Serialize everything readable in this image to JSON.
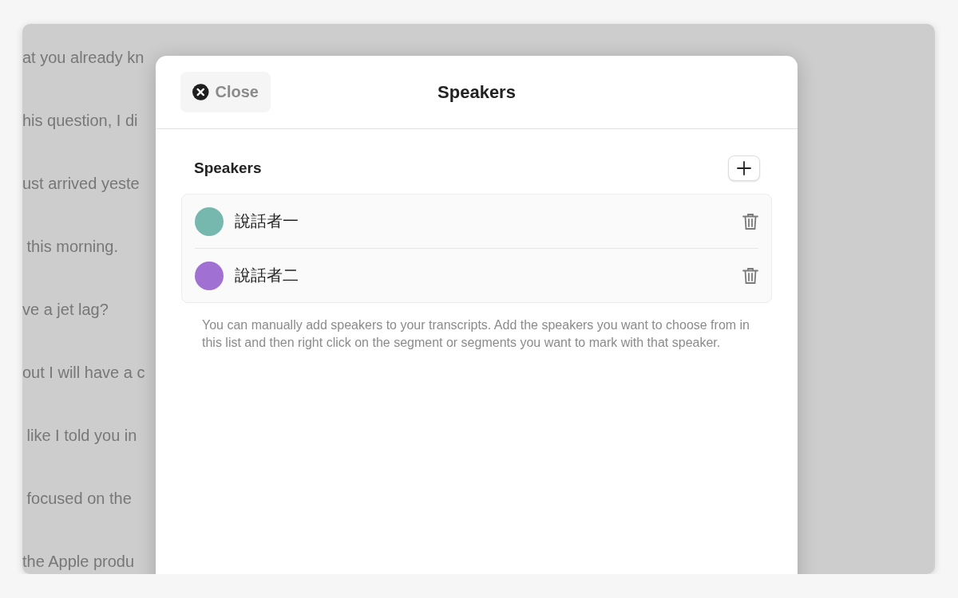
{
  "transcript_lines": [
    "at you already kn",
    "his question, I di",
    "ust arrived yeste",
    " this morning.",
    "ve a jet lag?",
    "out I will have a c",
    " like I told you in",
    " focused on the ",
    "the Apple produ"
  ],
  "dialog": {
    "close_label": "Close",
    "title": "Speakers",
    "section_title": "Speakers",
    "speakers": [
      {
        "name": "說話者一",
        "color": "#76b8ad"
      },
      {
        "name": "說話者二",
        "color": "#a070d2"
      }
    ],
    "help_text": "You can manually add speakers to your transcripts. Add the speakers you want to choose from in this list and then right click on the segment or segments you want to mark with that speaker."
  }
}
